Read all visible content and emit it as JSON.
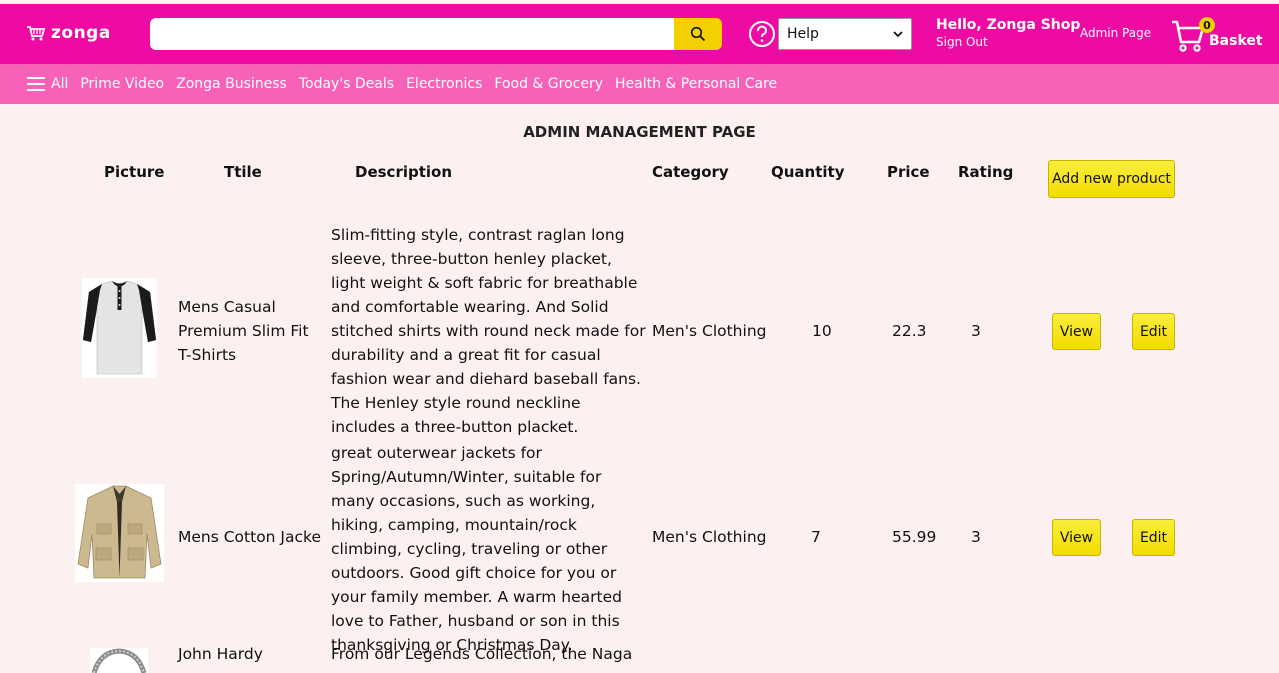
{
  "header": {
    "logo_text": "zonga",
    "search": {
      "value": "",
      "placeholder": ""
    },
    "help_select": {
      "selected": "Help"
    },
    "greeting": "Hello, Zonga Shop",
    "sign_out": "Sign Out",
    "admin_link": "Admin Page",
    "basket": {
      "count": "0",
      "label": "Basket"
    }
  },
  "nav": {
    "all_label": "All",
    "items": [
      "Prime Video",
      "Zonga Business",
      "Today's Deals",
      "Electronics",
      "Food & Grocery",
      "Health & Personal Care"
    ]
  },
  "main": {
    "title": "ADMIN MANAGEMENT PAGE",
    "columns": [
      "Picture",
      "Ttile",
      "Description",
      "Category",
      "Quantity",
      "Price",
      "Rating"
    ],
    "add_button": "Add new product",
    "view_label": "View",
    "edit_label": "Edit",
    "rows": [
      {
        "title": "Mens Casual Premium Slim Fit T-Shirts",
        "description": "Slim-fitting style, contrast raglan long sleeve, three-button henley placket, light weight & soft fabric for breathable and comfortable wearing. And Solid stitched shirts with round neck made for durability and a great fit for casual fashion wear and diehard baseball fans. The Henley style round neckline includes a three-button placket.",
        "category": "Men's Clothing",
        "quantity": "10",
        "price": "22.3",
        "rating": "3"
      },
      {
        "title": "Mens Cotton Jacke",
        "description": "great outerwear jackets for Spring/Autumn/Winter, suitable for many occasions, such as working, hiking, camping, mountain/rock climbing, cycling, traveling or other outdoors. Good gift choice for you or your family member. A warm hearted love to Father, husband or son in this thanksgiving or Christmas Day.",
        "category": "Men's Clothing",
        "quantity": "7",
        "price": "55.99",
        "rating": "3"
      },
      {
        "title": "John Hardy",
        "description": "From our Legends Collection, the Naga was"
      }
    ]
  },
  "colors": {
    "header_bg": "#ee0ba3",
    "nav_bg": "#f762b8",
    "page_bg": "#fdf0f1",
    "button_yellow": "#f8e81c"
  }
}
